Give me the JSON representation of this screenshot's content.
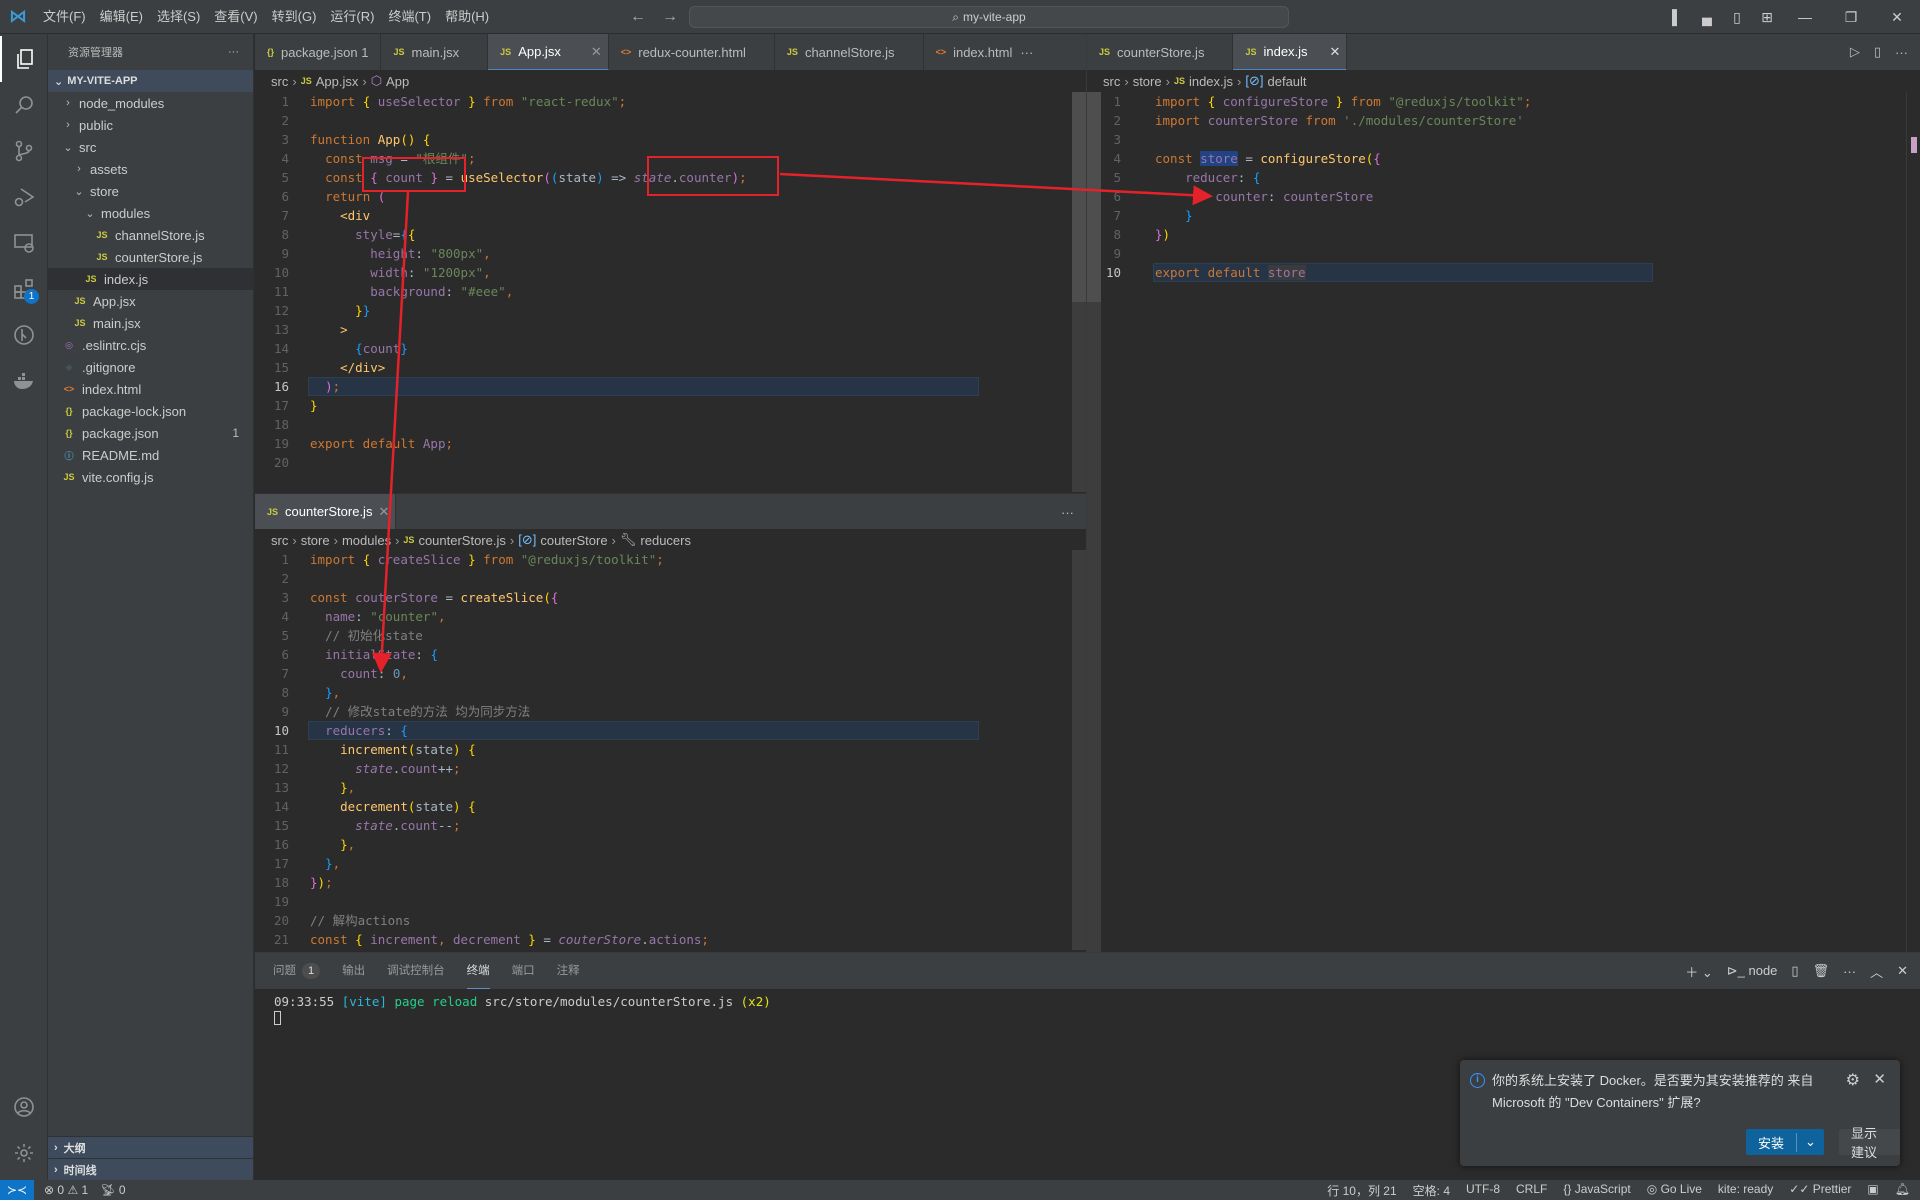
{
  "titlebar": {
    "menu": [
      "文件(F)",
      "编辑(E)",
      "选择(S)",
      "查看(V)",
      "转到(G)",
      "运行(R)",
      "终端(T)",
      "帮助(H)"
    ],
    "search_text": "my-vite-app",
    "back": "←",
    "forward": "→"
  },
  "sidebar": {
    "title": "资源管理器",
    "more": "···",
    "project": "MY-VITE-APP",
    "tree": [
      {
        "name": "node_modules",
        "type": "folder",
        "expanded": false,
        "depth": 1
      },
      {
        "name": "public",
        "type": "folder",
        "expanded": false,
        "depth": 1
      },
      {
        "name": "src",
        "type": "folder",
        "expanded": true,
        "depth": 1
      },
      {
        "name": "assets",
        "type": "folder",
        "expanded": false,
        "depth": 2
      },
      {
        "name": "store",
        "type": "folder",
        "expanded": true,
        "depth": 2
      },
      {
        "name": "modules",
        "type": "folder",
        "expanded": true,
        "depth": 3
      },
      {
        "name": "channelStore.js",
        "type": "js",
        "depth": 4
      },
      {
        "name": "counterStore.js",
        "type": "js",
        "depth": 4
      },
      {
        "name": "index.js",
        "type": "js",
        "depth": 3,
        "selected": true
      },
      {
        "name": "App.jsx",
        "type": "js",
        "depth": 2
      },
      {
        "name": "main.jsx",
        "type": "js",
        "depth": 2
      },
      {
        "name": ".eslintrc.cjs",
        "type": "eslint",
        "depth": 1
      },
      {
        "name": ".gitignore",
        "type": "git",
        "depth": 1
      },
      {
        "name": "index.html",
        "type": "html",
        "depth": 1
      },
      {
        "name": "package-lock.json",
        "type": "json",
        "depth": 1
      },
      {
        "name": "package.json",
        "type": "json",
        "depth": 1,
        "count": "1"
      },
      {
        "name": "README.md",
        "type": "info",
        "depth": 1
      },
      {
        "name": "vite.config.js",
        "type": "js",
        "depth": 1
      }
    ],
    "sections": [
      "大纲",
      "时间线"
    ]
  },
  "activity": {
    "items": [
      "explorer-icon",
      "search-icon",
      "source-control-icon",
      "run-debug-icon",
      "remote-explorer-icon",
      "extensions-icon",
      "gitlens-icon",
      "docker-icon"
    ],
    "extensions_badge": "1"
  },
  "editor_left": {
    "tabs": [
      {
        "label": "package.json 1",
        "icon": "{}",
        "type": "json"
      },
      {
        "label": "main.jsx",
        "icon": "JS",
        "type": "js"
      },
      {
        "label": "App.jsx",
        "icon": "JS",
        "type": "js",
        "active": true
      },
      {
        "label": "redux-counter.html",
        "icon": "<>",
        "type": "html"
      },
      {
        "label": "channelStore.js",
        "icon": "JS",
        "type": "js"
      },
      {
        "label": "index.html",
        "icon": "<>",
        "type": "html"
      }
    ],
    "more": "···",
    "breadcrumb": [
      "src",
      "App.jsx",
      "App"
    ],
    "current_line": 16
  },
  "editor_right": {
    "tabs": [
      {
        "label": "counterStore.js",
        "icon": "JS",
        "type": "js"
      },
      {
        "label": "index.js",
        "icon": "JS",
        "type": "js",
        "active": true
      }
    ],
    "breadcrumb": [
      "src",
      "store",
      "index.js",
      "default"
    ],
    "current_line": 10
  },
  "editor_bottom": {
    "tabs": [
      {
        "label": "counterStore.js",
        "icon": "JS",
        "type": "js",
        "active": true
      }
    ],
    "more": "···",
    "breadcrumb": [
      "src",
      "store",
      "modules",
      "counterStore.js",
      "couterStore",
      "reducers"
    ],
    "current_line": 10
  },
  "panel": {
    "tabs": [
      {
        "label": "问题",
        "badge": "1"
      },
      {
        "label": "输出"
      },
      {
        "label": "调试控制台"
      },
      {
        "label": "终端",
        "active": true
      },
      {
        "label": "端口"
      },
      {
        "label": "注释"
      }
    ],
    "terminal_name": "node",
    "terminal_lines": [
      {
        "time": "09:33:55",
        "tag": "[vite]",
        "action": "page reload",
        "path": "src/store/modules/counterStore.js",
        "count": "(x2)"
      }
    ]
  },
  "notification": {
    "message": "你的系统上安装了 Docker。是否要为其安装推荐的 来自 Microsoft 的 \"Dev Containers\" 扩展?",
    "install_label": "安装",
    "suggest_label": "显示建议"
  },
  "statusbar": {
    "errors": "0",
    "warnings": "1",
    "ports": "0",
    "position": "行 10，列 21",
    "spaces": "空格: 4",
    "encoding": "UTF-8",
    "eol": "CRLF",
    "language": "JavaScript",
    "golive": "Go Live",
    "kite": "kite: ready",
    "prettier": "Prettier"
  },
  "colors": {
    "accent": "#0e74c8",
    "annotation": "#e5222a",
    "install_button": "#0e639c"
  }
}
